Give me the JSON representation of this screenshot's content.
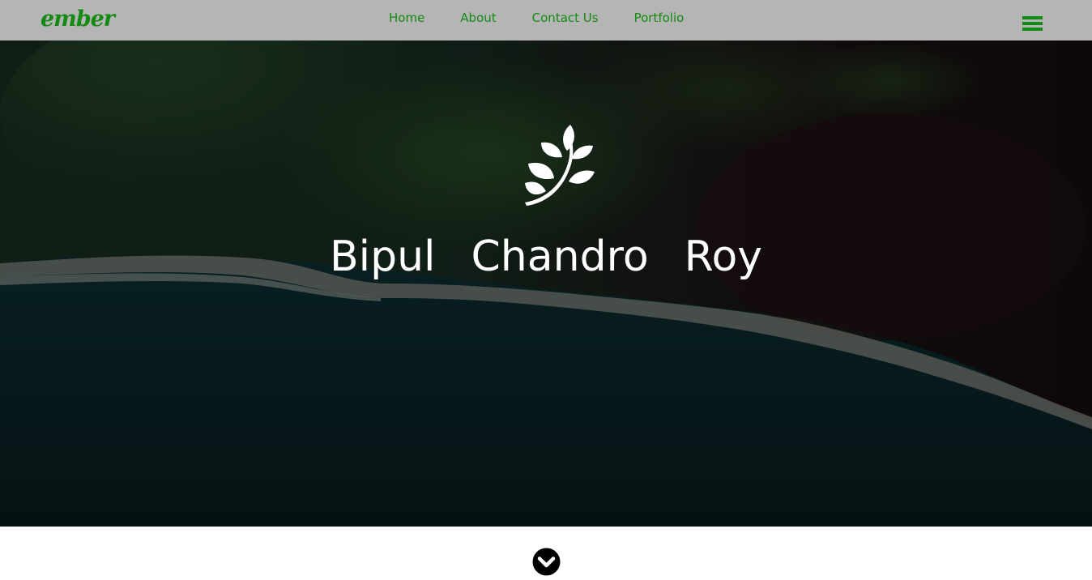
{
  "navbar": {
    "brand": "ember",
    "links": [
      "Home",
      "About",
      "Contact Us",
      "Portfolio"
    ],
    "menu_icon": "hamburger-menu-icon"
  },
  "hero": {
    "logo_icon": "leaf-sprig-icon",
    "name_words": [
      "Bipul",
      "Chandro",
      "Roy"
    ]
  },
  "scroll": {
    "icon": "chevron-down-circle-icon"
  },
  "colors": {
    "accent": "#138a13",
    "navbar_bg": "#b5b5b5",
    "hero_text": "#ffffff"
  }
}
